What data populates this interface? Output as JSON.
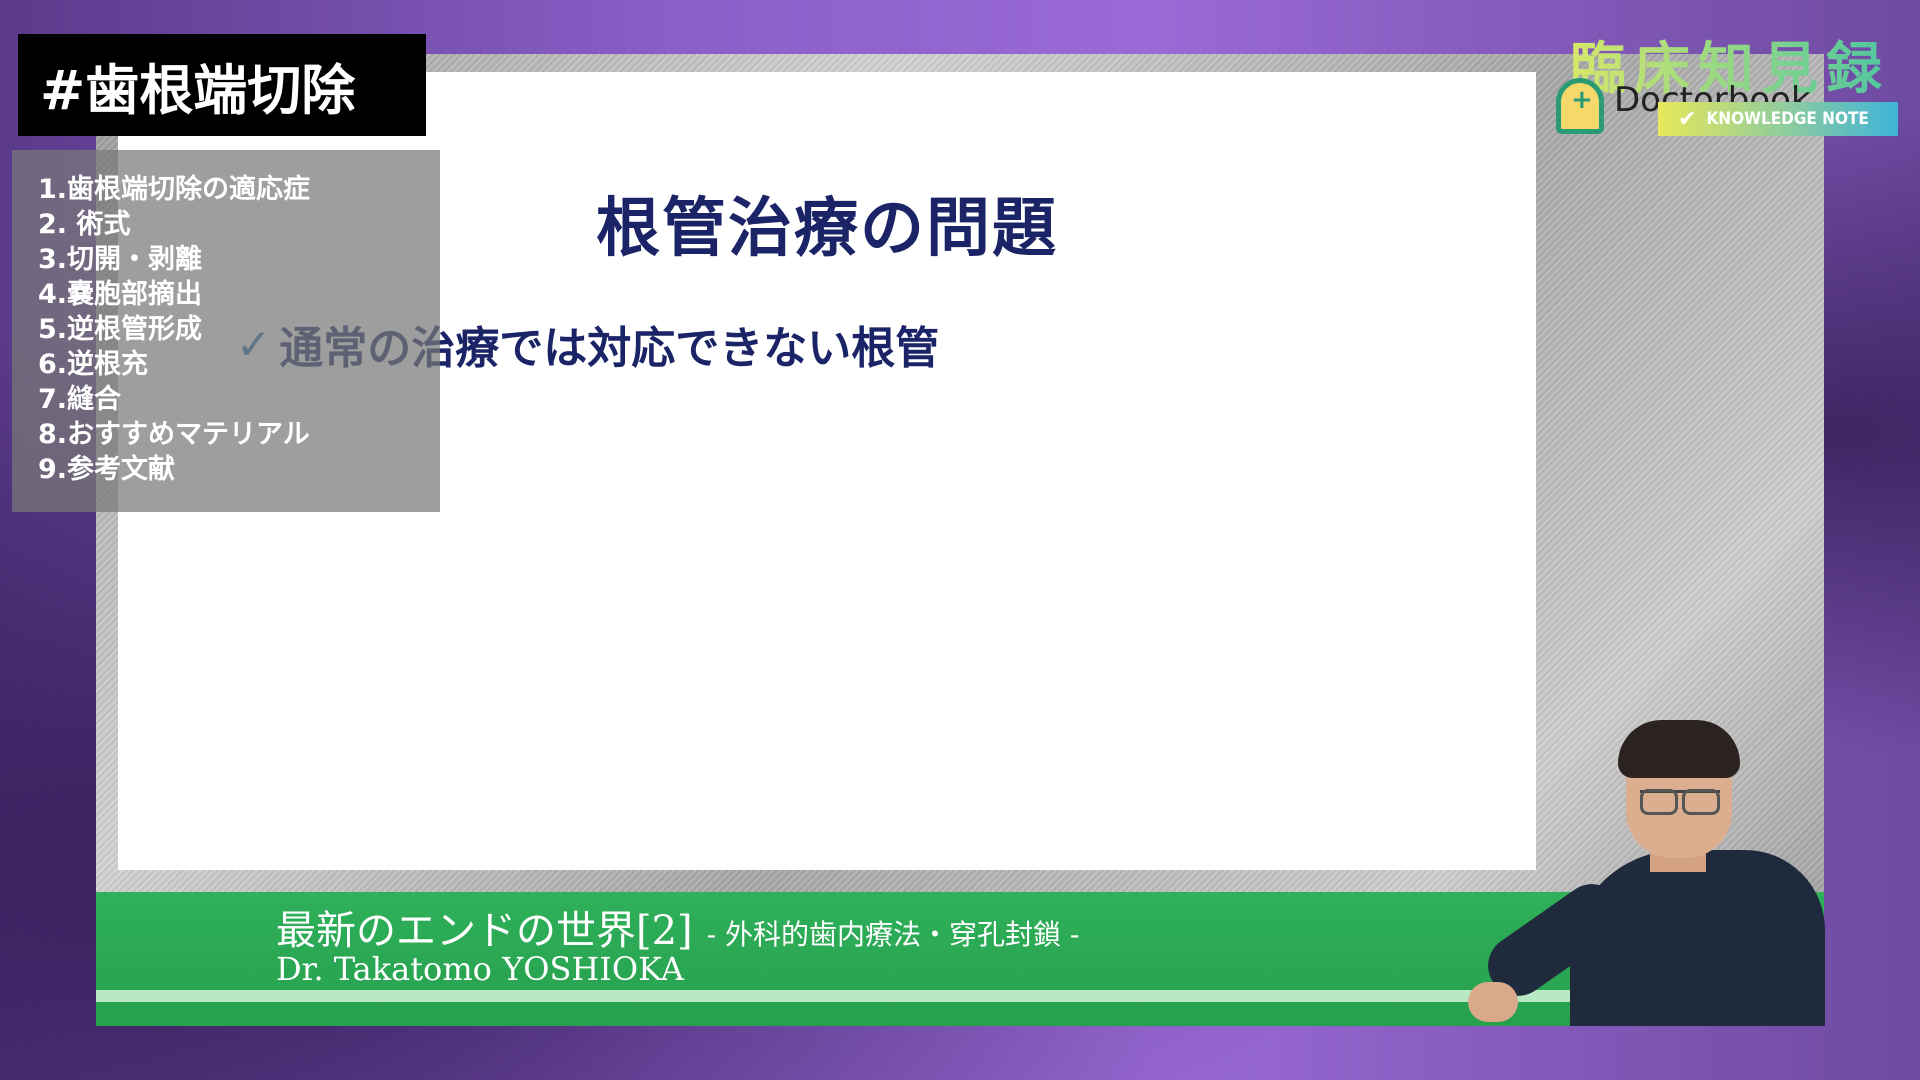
{
  "hashtag": "#歯根端切除",
  "toc": [
    "1.歯根端切除の適応症",
    "2. 術式",
    "3.切開・剥離",
    "4.嚢胞部摘出",
    "5.逆根管形成",
    "6.逆根充",
    "7.縫合",
    "8.おすすめマテリアル",
    "9.参考文献"
  ],
  "slide": {
    "title": "根管治療の問題",
    "bullet_mark": "✓",
    "bullet": "通常の治療では対応できない根管"
  },
  "brand": {
    "title": "臨床知見録",
    "logo_text": "Doctorbook",
    "note_label": "KNOWLEDGE NOTE",
    "logo_icon": "doctorbook-logo-icon",
    "check_icon": "check-icon"
  },
  "lower_third": {
    "title": "最新のエンドの世界[2]",
    "subtitle": "- 外科的歯内療法・穿孔封鎖 -",
    "presenter": "Dr. Takatomo YOSHIOKA"
  },
  "colors": {
    "slide_text": "#1a2466",
    "check": "#1e6fb0",
    "lower_third_green": "#2fb05a",
    "toc_bg": "#787878"
  }
}
